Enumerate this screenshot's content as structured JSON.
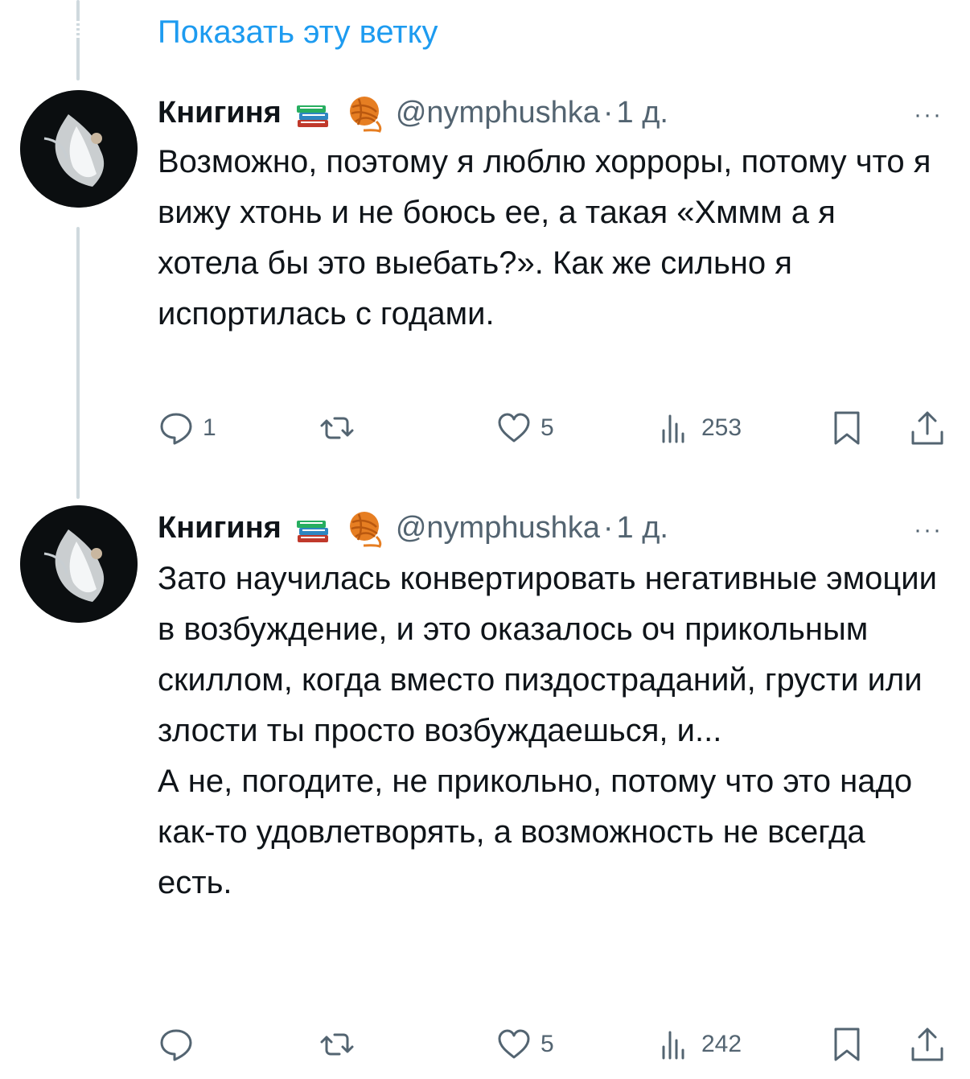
{
  "thread": {
    "show_thread_label": "Показать эту ветку"
  },
  "tweets": [
    {
      "author_name": "Книгиня",
      "emojis": [
        "books-emoji",
        "yarn-emoji"
      ],
      "handle": "@nymphushka",
      "separator": "·",
      "time": "1 д.",
      "more": "···",
      "text": "Возможно, поэтому я люблю хорроры, потому что я вижу хтонь и не боюсь ее, а такая «Хммм а я хотела бы это выебать?». Как же сильно я испортилась с годами.",
      "reply_count": "1",
      "retweet_count": "",
      "like_count": "5",
      "views_count": "253"
    },
    {
      "author_name": "Книгиня",
      "emojis": [
        "books-emoji",
        "yarn-emoji"
      ],
      "handle": "@nymphushka",
      "separator": "·",
      "time": "1 д.",
      "more": "···",
      "text": "Зато научилась конвертировать негативные эмоции в возбуждение, и это оказалось оч прикольным скиллом, когда вместо пиздостраданий, грусти или злости ты просто возбуждаешься, и...\nА не, погодите, не прикольно, потому что это надо как-то удовлетворять, а возможность не всегда есть.",
      "reply_count": "",
      "retweet_count": "",
      "like_count": "5",
      "views_count": "242"
    }
  ],
  "colors": {
    "link": "#1d9bf0",
    "secondary_text": "#536471",
    "primary_text": "#0f1419",
    "thread_line": "#cfd9de"
  }
}
